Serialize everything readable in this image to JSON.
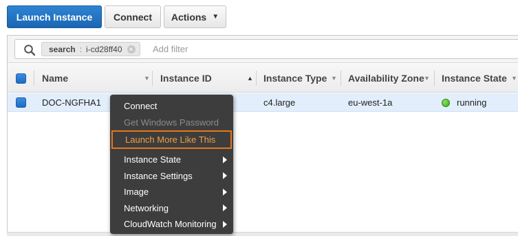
{
  "toolbar": {
    "launch_label": "Launch Instance",
    "connect_label": "Connect",
    "actions_label": "Actions",
    "primary_color": "#1f6fbf"
  },
  "filter": {
    "token_key": "search",
    "token_sep": ":",
    "token_value": "i-cd28ff40",
    "placeholder": "Add filter"
  },
  "table": {
    "columns": [
      "Name",
      "Instance ID",
      "Instance Type",
      "Availability Zone",
      "Instance State"
    ],
    "rows": [
      {
        "name": "DOC-NGFHA1",
        "instance_type": "c4.large",
        "availability_zone": "eu-west-1a",
        "instance_state": "running",
        "state_color": "#3aa51b"
      }
    ]
  },
  "context_menu": {
    "accent_color": "#e8771a",
    "items": [
      {
        "label": "Connect",
        "enabled": true,
        "submenu": false
      },
      {
        "label": "Get Windows Password",
        "enabled": false,
        "submenu": false
      },
      {
        "label": "Launch More Like This",
        "enabled": true,
        "submenu": false,
        "highlighted": true
      },
      {
        "label": "Instance State",
        "enabled": true,
        "submenu": true
      },
      {
        "label": "Instance Settings",
        "enabled": true,
        "submenu": true
      },
      {
        "label": "Image",
        "enabled": true,
        "submenu": true
      },
      {
        "label": "Networking",
        "enabled": true,
        "submenu": true
      },
      {
        "label": "CloudWatch Monitoring",
        "enabled": true,
        "submenu": true
      }
    ]
  }
}
